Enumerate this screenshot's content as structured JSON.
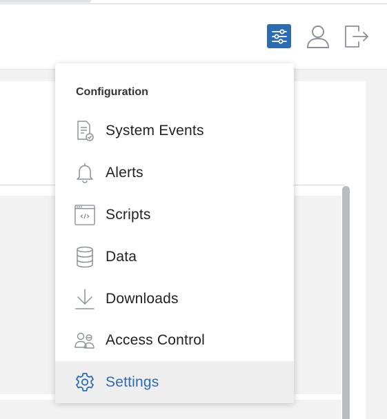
{
  "colors": {
    "accent": "#2b6cb0",
    "icon_gray": "#8a8f98",
    "active_bg": "#eeeeee"
  },
  "header": {
    "icons": [
      "sliders-icon",
      "user-icon",
      "logout-icon"
    ]
  },
  "menu": {
    "heading": "Configuration",
    "items": [
      {
        "label": "System Events",
        "icon": "document-check-icon",
        "active": false
      },
      {
        "label": "Alerts",
        "icon": "bell-icon",
        "active": false
      },
      {
        "label": "Scripts",
        "icon": "code-window-icon",
        "active": false
      },
      {
        "label": "Data",
        "icon": "database-icon",
        "active": false
      },
      {
        "label": "Downloads",
        "icon": "download-icon",
        "active": false
      },
      {
        "label": "Access Control",
        "icon": "users-icon",
        "active": false
      },
      {
        "label": "Settings",
        "icon": "gear-icon",
        "active": true
      }
    ]
  }
}
